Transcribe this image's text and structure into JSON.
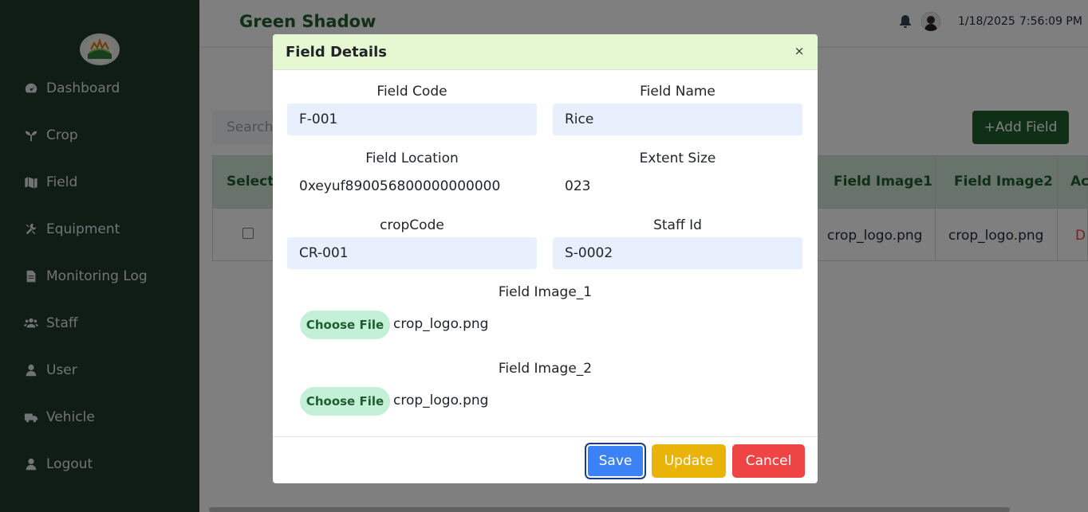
{
  "app": {
    "brand": "Green Shadow"
  },
  "header": {
    "date": "1/18/2025",
    "time": "7:56:09 PM"
  },
  "sidebar": {
    "items": [
      {
        "label": "Dashboard",
        "icon": "gauge-icon"
      },
      {
        "label": "Crop",
        "icon": "seedling-icon"
      },
      {
        "label": "Field",
        "icon": "map-icon"
      },
      {
        "label": "Equipment",
        "icon": "tools-icon"
      },
      {
        "label": "Monitoring Log",
        "icon": "file-icon"
      },
      {
        "label": "Staff",
        "icon": "users-icon"
      },
      {
        "label": "User",
        "icon": "user-icon"
      },
      {
        "label": "Vehicle",
        "icon": "truck-icon"
      },
      {
        "label": "Logout",
        "icon": "user-icon"
      }
    ]
  },
  "main": {
    "search_placeholder": "Search",
    "add_button": "+Add Field",
    "table": {
      "headers": {
        "select": "Select",
        "image1": "Field Image1",
        "image2": "Field Image2",
        "actions": "Ac"
      },
      "row": {
        "image1": "crop_logo.png",
        "image2": "crop_logo.png",
        "action": "D"
      }
    }
  },
  "modal": {
    "title": "Field Details",
    "close": "×",
    "fields": {
      "code_label": "Field Code",
      "code_value": "F-001",
      "name_label": "Field Name",
      "name_value": "Rice",
      "location_label": "Field Location",
      "location_value": "0xeyuf890056800000000000",
      "extent_label": "Extent Size",
      "extent_value": "023",
      "crop_label": "cropCode",
      "crop_value": "CR-001",
      "staff_label": "Staff Id",
      "staff_value": "S-0002"
    },
    "image1": {
      "label": "Field Image_1",
      "button": "Choose File",
      "file": "crop_logo.png"
    },
    "image2": {
      "label": "Field Image_2",
      "button": "Choose File",
      "file": "crop_logo.png"
    },
    "buttons": {
      "save": "Save",
      "update": "Update",
      "cancel": "Cancel"
    }
  }
}
